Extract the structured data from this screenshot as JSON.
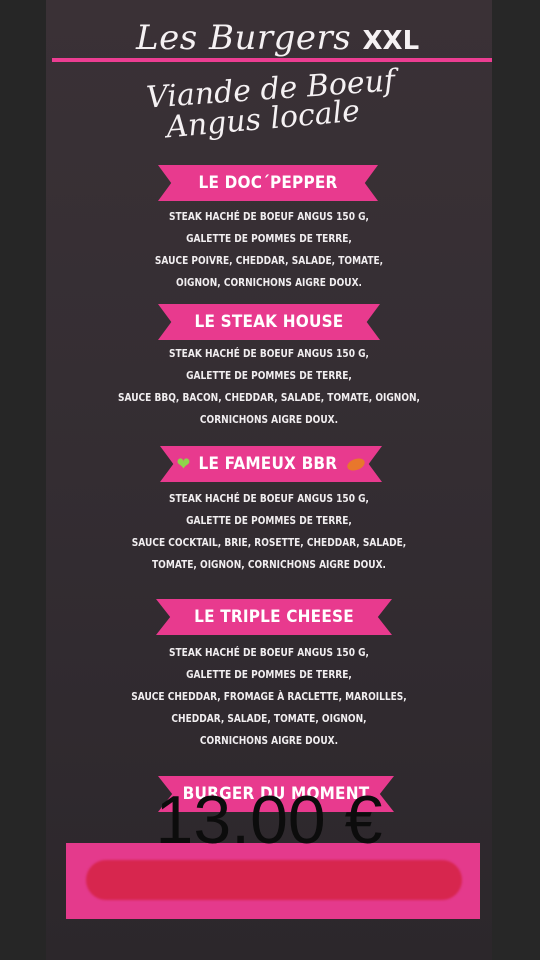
{
  "menu": {
    "title_main": "Les Burgers",
    "title_suffix": "XXL",
    "subtitle_1": "Viande de Boeuf",
    "subtitle_2": "Angus locale",
    "items": [
      {
        "name": "LE DOC´PEPPER",
        "lines": [
          "STEAK HACHÉ DE BOEUF ANGUS 150 G,",
          "GALETTE DE POMMES DE TERRE,",
          "SAUCE POIVRE, CHEDDAR, SALADE, TOMATE,",
          "OIGNON, CORNICHONS AIGRE DOUX."
        ]
      },
      {
        "name": "LE STEAK HOUSE",
        "lines": [
          "STEAK HACHÉ DE BOEUF ANGUS 150 G,",
          "GALETTE DE POMMES DE TERRE,",
          "SAUCE BBQ, BACON, CHEDDAR, SALADE, TOMATE, OIGNON,",
          "CORNICHONS AIGRE DOUX."
        ]
      },
      {
        "name": "LE FAMEUX BBR",
        "icon_left": "green-heart-icon",
        "icon_right": "rugby-ball-icon",
        "lines": [
          "STEAK HACHÉ DE BOEUF ANGUS 150 G,",
          "GALETTE DE POMMES DE TERRE,",
          "SAUCE COCKTAIL, BRIE, ROSETTE, CHEDDAR, SALADE,",
          "TOMATE, OIGNON, CORNICHONS AIGRE DOUX."
        ]
      },
      {
        "name": "LE TRIPLE CHEESE",
        "lines": [
          "STEAK HACHÉ DE BOEUF ANGUS 150 G,",
          "GALETTE DE POMMES DE TERRE,",
          "SAUCE CHEDDAR, FROMAGE À RACLETTE, MAROILLES,",
          "CHEDDAR, SALADE, TOMATE, OIGNON,",
          "CORNICHONS AIGRE DOUX."
        ]
      },
      {
        "name": "BURGER DU MOMENT"
      }
    ],
    "price": "13.00 €",
    "colors": {
      "accent_pink": "#e83a8e",
      "board": "#352e33",
      "text": "#f1eef0",
      "redaction": "#d7264e"
    }
  }
}
